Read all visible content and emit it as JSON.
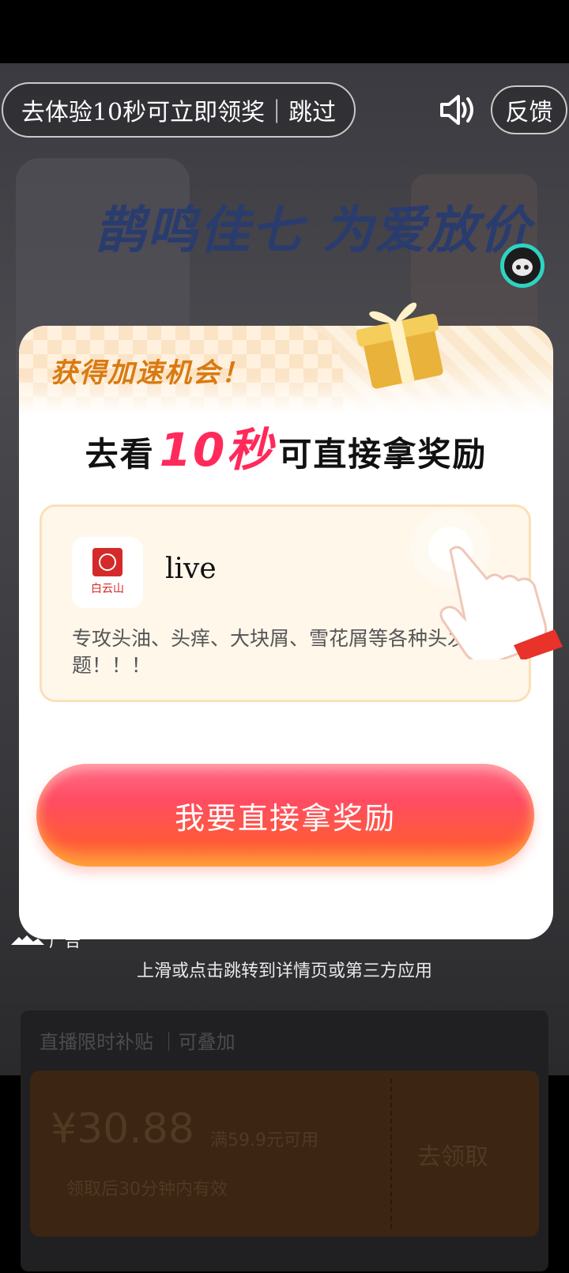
{
  "top_controls": {
    "skip_text": "去体验10秒可立即领奖｜跳过",
    "feedback_label": "反馈"
  },
  "ad_background": {
    "headline": "鹊鸣佳七 为爱放价"
  },
  "reward_card": {
    "title": "获得加速机会！",
    "subtitle_prefix": "去看",
    "subtitle_highlight": "10秒",
    "subtitle_suffix": "可直接拿奖励",
    "app": {
      "name": "live",
      "icon_text": "白云山",
      "description": "专攻头油、头痒、大块屑、雪花屑等各种头发问题！！！"
    },
    "cta_label": "我要直接拿奖励"
  },
  "ad_label": "广告",
  "swipe_hint": "上滑或点击跳转到详情页或第三方应用",
  "coupon": {
    "tag_text": "直播限时补贴 ｜可叠加",
    "price": "¥30.88",
    "condition": "满59.9元可用",
    "note": "领取后30分钟内有效",
    "action": "去领取"
  },
  "colors": {
    "accent_orange": "#d97a10",
    "highlight_pink": "#ff2a5a",
    "cta_gradient_top": "#ff6f88",
    "cta_gradient_bottom": "#ff8a36",
    "robot_ring": "#2fd3c2"
  },
  "icons": [
    "speaker-icon",
    "robot-icon",
    "gift-icon",
    "hand-pointer-icon",
    "ad-logo-icon",
    "app-icon"
  ]
}
